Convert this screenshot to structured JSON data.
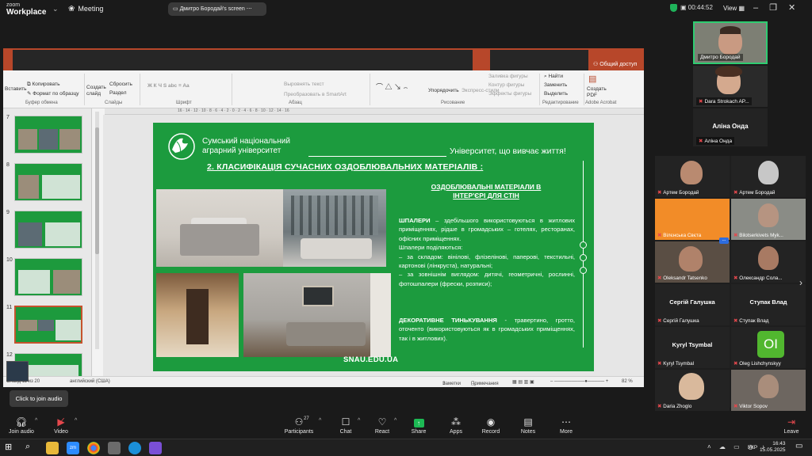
{
  "topbar": {
    "logo_line1": "zoom",
    "logo_line2": "Workplace",
    "meeting_label": "Meeting",
    "screen_share_label": "Дмитро Бородай's screen",
    "timer": "00:44:52",
    "view_label": "View"
  },
  "ppt": {
    "share_access": "Общий доступ",
    "ribbon": {
      "insert": "Вставить",
      "copy": "Копировать",
      "format_painter": "Формат по образцу",
      "clipboard_group": "Буфер обмена",
      "new_slide": "Создать слайд",
      "reset": "Сбросить",
      "section": "Раздел",
      "slides_group": "Слайды",
      "font_group": "Шрифт",
      "align_text": "Выровнять текст",
      "smartart": "Преобразовать в SmartArt",
      "paragraph_group": "Абзац",
      "arrange": "Упорядочить",
      "express_styles": "Экспресс-стили",
      "shape_fill": "Заливка фигуры",
      "shape_outline": "Контур фигуры",
      "shape_effects": "Эффекты фигуры",
      "drawing_group": "Рисование",
      "find": "Найти",
      "replace": "Заменить",
      "select": "Выделить",
      "editing_group": "Редактирование",
      "create_pdf": "Создать PDF",
      "acrobat_group": "Adobe Acrobat"
    },
    "thumbnails": [
      {
        "num": "7"
      },
      {
        "num": "8"
      },
      {
        "num": "9"
      },
      {
        "num": "10"
      },
      {
        "num": "11"
      },
      {
        "num": "12"
      }
    ],
    "status": {
      "slide": "Слайд 11 из 20",
      "language": "английский (США)",
      "notes": "Заметки",
      "comments": "Примечания",
      "zoom": "82 %"
    }
  },
  "slide": {
    "uni_name_line1": "Сумський національний",
    "uni_name_line2": "аграрний університет",
    "tagline": "Університет, що вивчає життя!",
    "title": "2. КЛАСИФІКАЦІЯ СУЧАСНИХ ОЗДОБЛЮВАЛЬНИХ МАТЕРІАЛІВ  :",
    "subheading_line1": "ОЗДОБЛЮВАЛЬНІ МАТЕРІАЛИ В",
    "subheading_line2": "ІНТЕР'ЄРІ ДЛЯ СТІН",
    "wallpaper_term": "ШПАЛЕРИ",
    "wallpaper_text": " – здебільшого використовуються в житлових приміщеннях, рідше в громадських – готелях, ресторанах, офісних приміщеннях.",
    "wallpaper_division": "Шпалери поділяються:",
    "wallpaper_composition": "– за складом: вінілові, флізелінові, паперові, текстильні, картонові (лінкруста), натуральні;",
    "wallpaper_appearance": "– за зовнішнім виглядом: дитячі, геометричні, рослинні, фотошпалери (фрески, розписи);",
    "plaster_term": "ДЕКОРАТИВНЕ ТИНЬКУВАННЯ",
    "plaster_text": " - травертино, гротто, оточенто (використовуються як в громадських приміщеннях, так і в житлових).",
    "website": "SNAU.EDU.UA"
  },
  "video": {
    "top_tile_name": "Дмитро Бородай",
    "dara_name": "Dara Strokach AP...",
    "alina_big": "Аліна Онда",
    "alina_name": "Аліна Онда",
    "grid": [
      {
        "name": "Артем Бородай",
        "big": ""
      },
      {
        "name": "Артем Бородай",
        "big": ""
      },
      {
        "name": "Вілєнська Свєта",
        "big": ""
      },
      {
        "name": "Bilotserkivets Myk...",
        "big": ""
      },
      {
        "name": "Oleksandr Tatsenko",
        "big": ""
      },
      {
        "name": "Олександр Сола...",
        "big": ""
      },
      {
        "name": "Сергій Галушка",
        "big": "Сергій Галушка"
      },
      {
        "name": "Ступак Влад",
        "big": "Ступак Влад"
      },
      {
        "name": "Kyryl Tsymbal",
        "big": "Kyryl Tsymbal"
      },
      {
        "name": "Oleg Lishchynskyy",
        "big": "OI"
      },
      {
        "name": "Daria Zhoglo",
        "big": ""
      },
      {
        "name": "Viktor Sopov",
        "big": ""
      }
    ],
    "more_label": "..."
  },
  "audio_prompt": "Click to join audio",
  "controls": {
    "join_audio": "Join audio",
    "video": "Video",
    "participants": "Participants",
    "participants_count": "27",
    "chat": "Chat",
    "react": "React",
    "share": "Share",
    "apps": "Apps",
    "record": "Record",
    "notes": "Notes",
    "more": "More",
    "leave": "Leave"
  },
  "taskbar": {
    "lang": "УКР",
    "time": "16:43",
    "date": "15.05.2025"
  },
  "colors": {
    "slide_green": "#1c9b3e",
    "ppt_red": "#b7472a",
    "active_speaker": "#2ecc71",
    "share_green": "#1db954",
    "mic_muted": "#e5484d"
  }
}
